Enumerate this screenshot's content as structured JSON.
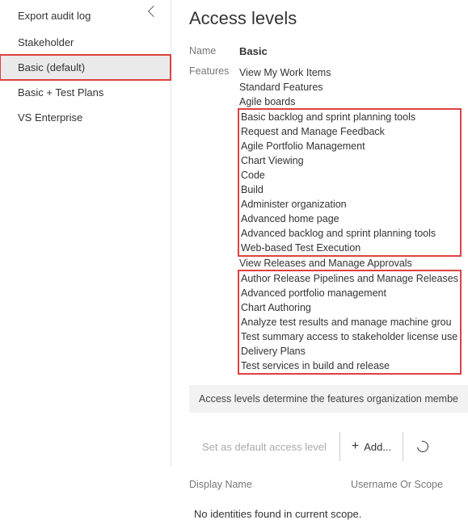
{
  "sidebar": {
    "export_label": "Export audit log",
    "levels": [
      {
        "label": "Stakeholder",
        "selected": false
      },
      {
        "label": "Basic (default)",
        "selected": true
      },
      {
        "label": "Basic + Test Plans",
        "selected": false
      },
      {
        "label": "VS Enterprise",
        "selected": false
      }
    ]
  },
  "main": {
    "title": "Access levels",
    "name_key": "Name",
    "name_val": "Basic",
    "features_key": "Features",
    "features_plain_top": [
      "View My Work Items",
      "Standard Features",
      "Agile boards"
    ],
    "features_hl1": [
      "Basic backlog and sprint planning tools",
      "Request and Manage Feedback",
      "Agile Portfolio Management",
      "Chart Viewing",
      "Code",
      "Build",
      "Administer organization",
      "Advanced home page",
      "Advanced backlog and sprint planning tools",
      "Web-based Test Execution"
    ],
    "features_plain_mid": [
      "View Releases and Manage Approvals"
    ],
    "features_hl2": [
      "Author Release Pipelines and Manage Releases",
      "Advanced portfolio management",
      "Chart Authoring",
      "Analyze test results and manage machine grou",
      "Test summary access to stakeholder license use",
      "Delivery Plans",
      "Test services in build and release"
    ],
    "info_text": "Access levels determine the features organization membe",
    "btn_default": "Set as default access level",
    "btn_add": "Add...",
    "col_display": "Display Name",
    "col_user": "Username Or Scope",
    "empty_msg": "No identities found in current scope."
  }
}
